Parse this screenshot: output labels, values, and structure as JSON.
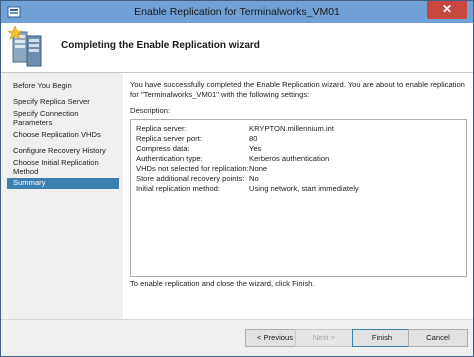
{
  "window": {
    "title": "Enable Replication for Terminalworks_VM01",
    "close_glyph": "✕"
  },
  "header": {
    "heading": "Completing the Enable Replication wizard",
    "icon": "server-replication-icon"
  },
  "nav": {
    "items": [
      {
        "label": "Before You Begin"
      },
      {
        "label": "Specify Replica Server"
      },
      {
        "label": "Specify Connection Parameters"
      },
      {
        "label": "Choose Replication VHDs"
      },
      {
        "label": "Configure Recovery History"
      },
      {
        "label": "Choose Initial Replication Method"
      },
      {
        "label": "Summary"
      }
    ],
    "active_index": 6
  },
  "main": {
    "intro": "You have successfully completed the Enable Replication wizard. You are about to enable replication for \"Terminalworks_VM01\" with the following settings:",
    "description_label": "Description:",
    "settings": [
      {
        "key": "Replica server:",
        "value": "KRYPTON.millennium.int"
      },
      {
        "key": "Replica server port:",
        "value": "80"
      },
      {
        "key": "Compress data:",
        "value": "Yes"
      },
      {
        "key": "Authentication type:",
        "value": "Kerberos authentication"
      },
      {
        "key": "VHDs not selected for replication:",
        "value": "None"
      },
      {
        "key": "Store additional recovery points:",
        "value": "No"
      },
      {
        "key": "Initial replication method:",
        "value": "Using network, start immediately"
      }
    ],
    "finish_note": "To enable replication and close the wizard, click Finish."
  },
  "footer": {
    "previous_label": "< Previous",
    "next_label": "Next >",
    "finish_label": "Finish",
    "cancel_label": "Cancel"
  },
  "colors": {
    "titlebar": "#6fa0d6",
    "selected_nav": "#3c7fb1",
    "close_button": "#c7463e"
  }
}
